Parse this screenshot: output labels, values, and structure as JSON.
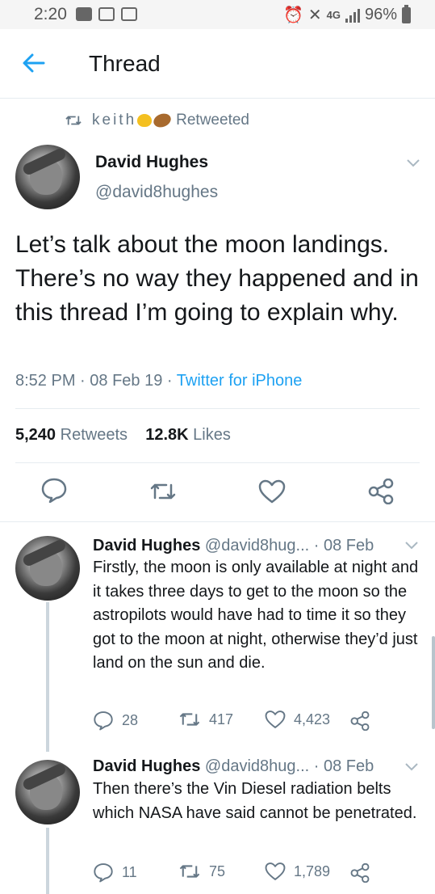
{
  "status_bar": {
    "time": "2:20",
    "network": "4G",
    "battery": "96%"
  },
  "header": {
    "title": "Thread"
  },
  "retweet_banner": {
    "user": "keith",
    "label": "Retweeted"
  },
  "main_tweet": {
    "name": "David Hughes",
    "handle": "@david8hughes",
    "text": "Let’s talk about the moon landings. There’s no way they happened and in this thread I’m going to explain why.",
    "time": "8:52 PM",
    "date": "08 Feb 19",
    "source": "Twitter for iPhone",
    "retweets_count": "5,240",
    "retweets_label": "Retweets",
    "likes_count": "12.8K",
    "likes_label": "Likes"
  },
  "replies": [
    {
      "name": "David Hughes",
      "handle": "@david8hug...",
      "date": "· 08 Feb",
      "text": "Firstly, the moon is only available at night and it takes three days to get to the moon so the astropilots would have had to time it so they got to the moon at night, otherwise they’d just land on the sun and die.",
      "replies": "28",
      "retweets": "417",
      "likes": "4,423"
    },
    {
      "name": "David Hughes",
      "handle": "@david8hug...",
      "date": "· 08 Feb",
      "text": "Then there’s the Vin Diesel radiation belts which NASA have said cannot be penetrated.",
      "replies": "11",
      "retweets": "75",
      "likes": "1,789"
    }
  ],
  "colors": {
    "accent": "#1da1f2",
    "muted": "#657786",
    "text": "#14171a",
    "divider": "#e6ecf0"
  },
  "icons": [
    "back-arrow-icon",
    "retweet-icon",
    "reply-icon",
    "like-icon",
    "share-icon",
    "chevron-down-icon"
  ]
}
